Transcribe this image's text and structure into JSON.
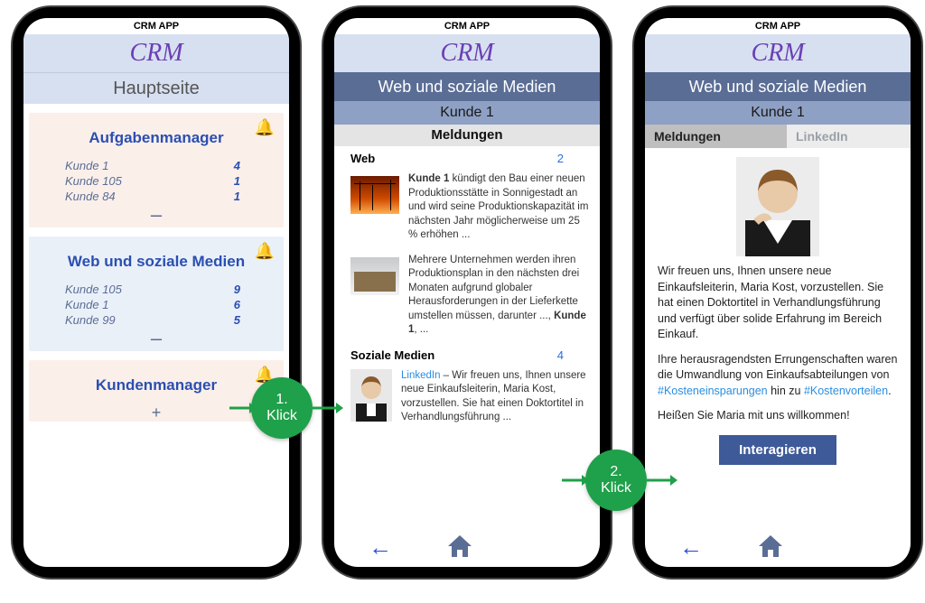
{
  "app_name": "CRM APP",
  "brand": "CRM",
  "phone1": {
    "page_title": "Hauptseite",
    "cards": {
      "tasks": {
        "title": "Aufgabenmanager",
        "rows": [
          {
            "label": "Kunde 1",
            "count": "4"
          },
          {
            "label": "Kunde 105",
            "count": "1"
          },
          {
            "label": "Kunde 84",
            "count": "1"
          }
        ],
        "toggle": "–"
      },
      "web": {
        "title": "Web und soziale Medien",
        "rows": [
          {
            "label": "Kunde 105",
            "count": "9"
          },
          {
            "label": "Kunde 1",
            "count": "6"
          },
          {
            "label": "Kunde 99",
            "count": "5"
          }
        ],
        "toggle": "–"
      },
      "customers": {
        "title": "Kundenmanager",
        "toggle": "+"
      }
    }
  },
  "phone2": {
    "header": "Web und soziale Medien",
    "customer": "Kunde 1",
    "section_title": "Meldungen",
    "web_label": "Web",
    "web_count": "2",
    "social_label": "Soziale Medien",
    "social_count": "4",
    "news1_bold": "Kunde 1",
    "news1_rest": " kündigt den Bau einer neuen Produktionsstätte in Sonnigestadt an und wird seine Produktionskapazität im nächsten Jahr möglicherweise um 25 % erhöhen ...",
    "news2_a": "Mehrere Unternehmen werden ihren Produktionsplan in den nächsten drei Monaten aufgrund globaler Herausforderungen in der Lieferkette umstellen müssen, darunter ..., ",
    "news2_bold": "Kunde 1",
    "news2_b": ", ...",
    "social1_link": "LinkedIn",
    "social1_rest": " – Wir freuen uns, Ihnen unsere neue Einkaufsleiterin, Maria Kost, vorzustellen. Sie hat einen Doktortitel in Verhandlungsführung ..."
  },
  "phone3": {
    "header": "Web und soziale Medien",
    "customer": "Kunde 1",
    "tab_active": "Meldungen",
    "tab_inactive": "LinkedIn",
    "p1": "Wir freuen uns, Ihnen unsere neue Einkaufsleiterin, Maria Kost, vorzustellen. Sie hat einen Doktortitel in Verhandlungsführung und verfügt über solide Erfahrung im Bereich Einkauf.",
    "p2a": "Ihre herausragendsten Errungenschaften waren die Umwandlung von Einkaufsabteilungen von ",
    "hash1": "#Kosteneinsparungen",
    "p2b": " hin zu ",
    "hash2": "#Kostenvorteilen",
    "p2c": ".",
    "p3": "Heißen Sie Maria mit uns willkommen!",
    "cta": "Interagieren"
  },
  "click1_num": "1.",
  "click1_word": "Klick",
  "click2_num": "2.",
  "click2_word": "Klick"
}
